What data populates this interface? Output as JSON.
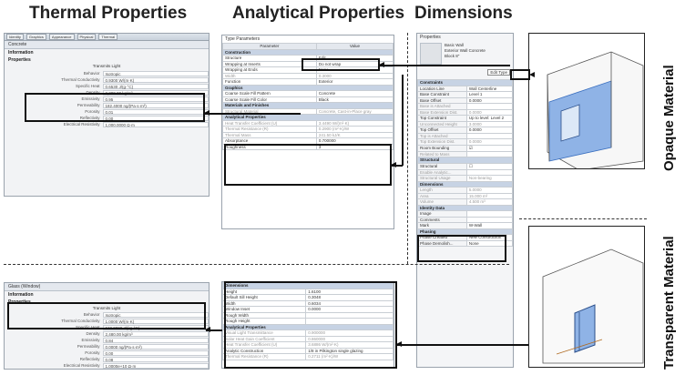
{
  "headings": {
    "thermal": "Thermal Properties",
    "analytical": "Analytical Properties",
    "dimensions": "Dimensions",
    "opaque": "Opaque Material",
    "transparent": "Transparent Material"
  },
  "top_thermal": {
    "tabs": [
      "Identity",
      "Graphics",
      "Appearance",
      "Physical",
      "Thermal"
    ],
    "name": "Concrete",
    "section_info": "Information",
    "section_props": "Properties",
    "transmits_light": "Transmits Light",
    "rows": [
      {
        "k": "Behavior",
        "v": "Isotropic"
      },
      {
        "k": "Thermal Conductivity",
        "v": "0.9300 W/(m·K)"
      },
      {
        "k": "Specific Heat",
        "v": "0.6530 J/(g·°C)"
      },
      {
        "k": "Density",
        "v": "2,300.00 kg/m³"
      },
      {
        "k": "Emissivity",
        "v": "0.95"
      },
      {
        "k": "Permeability",
        "v": "182.4000 ng/(Pa·s·m²)"
      },
      {
        "k": "Porosity",
        "v": "0.01"
      },
      {
        "k": "Reflectivity",
        "v": "0.00"
      },
      {
        "k": "Electrical Resistivity",
        "v": "1,000.0000 Ω·m"
      }
    ]
  },
  "bottom_thermal": {
    "name": "Glass (Window)",
    "section_info": "Information",
    "section_props": "Properties",
    "transmits_light": "Transmits Light",
    "rows": [
      {
        "k": "Behavior",
        "v": "Isotropic"
      },
      {
        "k": "Thermal Conductivity",
        "v": "1.0000 W/(m·K)"
      },
      {
        "k": "Specific Heat",
        "v": "840.0000 J/(kg·°C)"
      },
      {
        "k": "Density",
        "v": "2,480.00 kg/m³"
      },
      {
        "k": "Emissivity",
        "v": "0.84"
      },
      {
        "k": "Permeability",
        "v": "0.0000 ng/(Pa·s·m²)"
      },
      {
        "k": "Porosity",
        "v": "0.00"
      },
      {
        "k": "Reflectivity",
        "v": "0.08"
      },
      {
        "k": "Electrical Resistivity",
        "v": "1.0000e+10 Ω·m"
      }
    ]
  },
  "top_analytical": {
    "title": "Type Parameters",
    "col_param": "Parameter",
    "col_value": "Value",
    "rows": [
      {
        "sec": true,
        "k": "Construction",
        "v": ""
      },
      {
        "k": "Structure",
        "v": "Edit..."
      },
      {
        "k": "Wrapping at Inserts",
        "v": "Do not wrap"
      },
      {
        "k": "Wrapping at Ends",
        "v": "None"
      },
      {
        "k": "Width",
        "v": "0.3000",
        "grey": true
      },
      {
        "k": "Function",
        "v": "Exterior"
      },
      {
        "sec": true,
        "k": "Graphics",
        "v": ""
      },
      {
        "k": "Coarse Scale Fill Pattern",
        "v": "Concrete"
      },
      {
        "k": "Coarse Scale Fill Color",
        "v": "Black"
      },
      {
        "sec": true,
        "k": "Materials and Finishes",
        "v": ""
      },
      {
        "k": "Structural Material",
        "v": "Concrete, Cast-in-Place gray",
        "grey": true
      },
      {
        "sec": true,
        "k": "Analytical Properties",
        "v": ""
      },
      {
        "k": "Heat Transfer Coefficient (U)",
        "v": "3.4490 W/(m²·K)",
        "grey": true
      },
      {
        "k": "Thermal Resistance (R)",
        "v": "0.2900 (m²·K)/W",
        "grey": true
      },
      {
        "k": "Thermal Mass",
        "v": "241.50 kJ/K",
        "grey": true
      },
      {
        "k": "Absorptance",
        "v": "0.700000"
      },
      {
        "k": "Roughness",
        "v": "3"
      }
    ]
  },
  "bottom_analytical": {
    "rows": [
      {
        "sec": true,
        "k": "Dimensions",
        "v": ""
      },
      {
        "k": "Height",
        "v": "1.6100"
      },
      {
        "k": "Default Sill Height",
        "v": "0.3048"
      },
      {
        "k": "Width",
        "v": "0.6034"
      },
      {
        "k": "Window Inset",
        "v": "0.0000"
      },
      {
        "k": "Rough Width",
        "v": ""
      },
      {
        "k": "Rough Height",
        "v": ""
      },
      {
        "sec": true,
        "k": "Analytical Properties",
        "v": ""
      },
      {
        "k": "Visual Light Transmittance",
        "v": "0.900000",
        "grey": true
      },
      {
        "k": "Solar Heat Gain Coefficient",
        "v": "0.860000",
        "grey": true
      },
      {
        "k": "Heat Transfer Coefficient (U)",
        "v": "3.6886 W/(m²·K)",
        "grey": true
      },
      {
        "k": "Analytic Construction",
        "v": "1/8 in Pilkington single glazing"
      },
      {
        "k": "Thermal Resistance (R)",
        "v": "0.2711 (m²·K)/W",
        "grey": true
      }
    ]
  },
  "dimensions_panel": {
    "title": "Properties",
    "family": "Basic Wall",
    "type": "Exterior Wall Concrete",
    "sub": "Block 8\"",
    "edit_type": "Edit Type",
    "rows": [
      {
        "sec": true,
        "k": "Constraints",
        "v": ""
      },
      {
        "k": "Location Line",
        "v": "Wall Centerline"
      },
      {
        "k": "Base Constraint",
        "v": "Level 1"
      },
      {
        "k": "Base Offset",
        "v": "0.0000"
      },
      {
        "k": "Base is Attached",
        "v": "",
        "grey": true
      },
      {
        "k": "Base Extension Dist.",
        "v": "0.0000",
        "grey": true
      },
      {
        "k": "Top Constraint",
        "v": "Up to level: Level 2"
      },
      {
        "k": "Unconnected Height",
        "v": "3.0000",
        "grey": true
      },
      {
        "k": "Top Offset",
        "v": "0.0000"
      },
      {
        "k": "Top is Attached",
        "v": "",
        "grey": true
      },
      {
        "k": "Top Extension Dist.",
        "v": "0.0000",
        "grey": true
      },
      {
        "k": "Room Bounding",
        "v": "☑"
      },
      {
        "k": "Related to Mass",
        "v": "",
        "grey": true
      },
      {
        "sec": true,
        "k": "Structural",
        "v": ""
      },
      {
        "k": "Structural",
        "v": "☐"
      },
      {
        "k": "Enable Analytic...",
        "v": "",
        "grey": true
      },
      {
        "k": "Structural Usage",
        "v": "Non-bearing",
        "grey": true
      },
      {
        "sec": true,
        "k": "Dimensions",
        "v": ""
      },
      {
        "k": "Length",
        "v": "5.0000",
        "grey": true
      },
      {
        "k": "Area",
        "v": "15.000 m²",
        "grey": true
      },
      {
        "k": "Volume",
        "v": "4.500 m³",
        "grey": true
      },
      {
        "sec": true,
        "k": "Identity Data",
        "v": ""
      },
      {
        "k": "Image",
        "v": ""
      },
      {
        "k": "Comments",
        "v": ""
      },
      {
        "k": "Mark",
        "v": "W-Wall"
      },
      {
        "sec": true,
        "k": "Phasing",
        "v": ""
      },
      {
        "k": "Phase Created",
        "v": "New Construction"
      },
      {
        "k": "Phase Demolish...",
        "v": "None"
      }
    ]
  }
}
